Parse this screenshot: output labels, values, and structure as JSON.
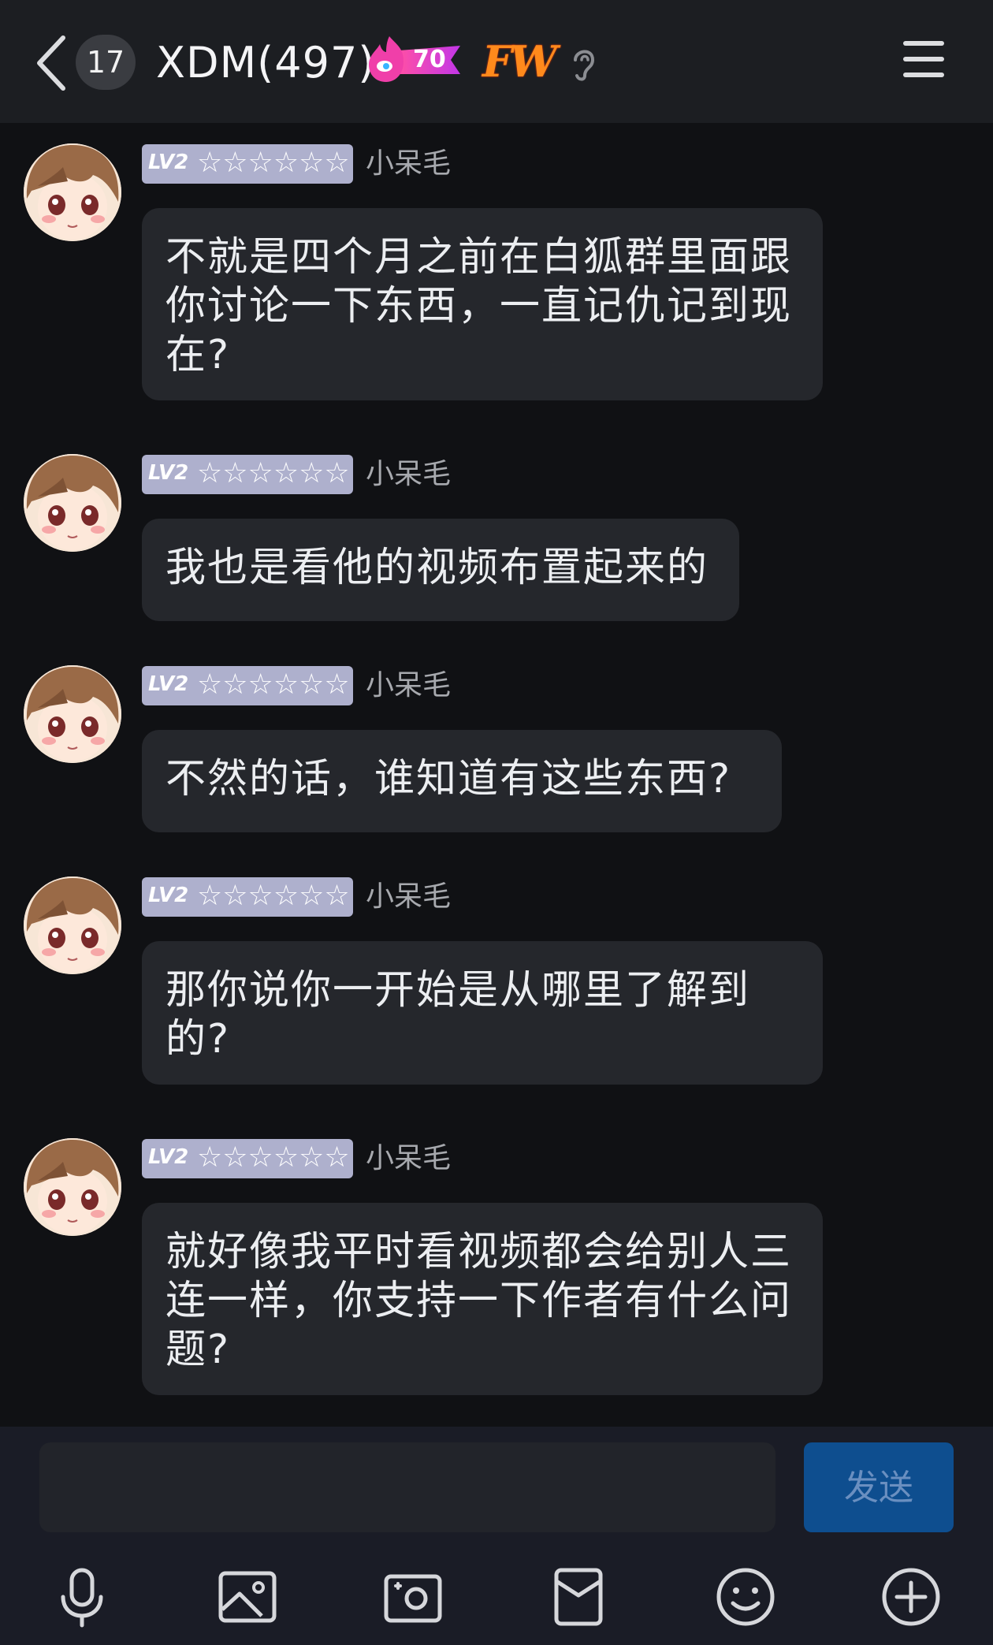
{
  "header": {
    "unread_count": "17",
    "title": "XDM(497)",
    "fire_level": "70",
    "badge_text": "FW",
    "icons": [
      "back-arrow-icon",
      "fire-badge-icon",
      "ear-icon",
      "menu-icon"
    ]
  },
  "messages": [
    {
      "level": "LV2",
      "stars": "☆☆☆☆☆☆",
      "sender": "小呆毛",
      "text": "不就是四个月之前在白狐群里面跟你讨论一下东西，一直记仇记到现在?"
    },
    {
      "level": "LV2",
      "stars": "☆☆☆☆☆☆",
      "sender": "小呆毛",
      "text": "我也是看他的视频布置起来的"
    },
    {
      "level": "LV2",
      "stars": "☆☆☆☆☆☆",
      "sender": "小呆毛",
      "text": "不然的话，谁知道有这些东西?"
    },
    {
      "level": "LV2",
      "stars": "☆☆☆☆☆☆",
      "sender": "小呆毛",
      "text": "那你说你一开始是从哪里了解到的?"
    },
    {
      "level": "LV2",
      "stars": "☆☆☆☆☆☆",
      "sender": "小呆毛",
      "text": "就好像我平时看视频都会给别人三连一样，你支持一下作者有什么问题?"
    }
  ],
  "composer": {
    "input_value": "",
    "send_label": "发送"
  },
  "toolbar": {
    "icons": [
      "microphone-icon",
      "image-icon",
      "camera-icon",
      "red-packet-icon",
      "emoji-icon",
      "plus-icon"
    ]
  },
  "colors": {
    "background": "#101114",
    "header": "#1c1e22",
    "bubble": "#25272c",
    "level_tag": "#aeb0cd",
    "send_button": "#0e4e8f",
    "fire_badge": "#e93fb8",
    "fw_badge": "#ff8a1c"
  }
}
